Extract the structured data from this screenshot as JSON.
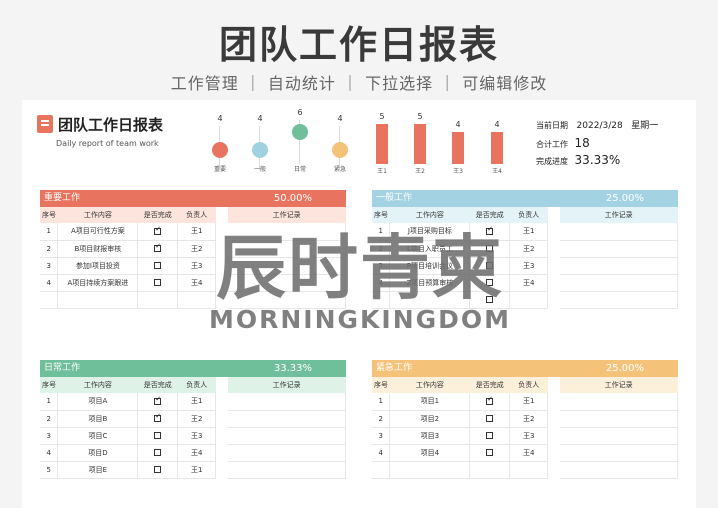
{
  "banner": {
    "title": "团队工作日报表",
    "subtitle": "工作管理 ｜ 自动统计 ｜ 下拉选择 ｜ 可编辑修改"
  },
  "sheet": {
    "title": "团队工作日报表",
    "subtitle": "Daily report of team work"
  },
  "categories": [
    {
      "count": "4",
      "label": "重要",
      "color": "#e8735f"
    },
    {
      "count": "4",
      "label": "一般",
      "color": "#9fd1e0"
    },
    {
      "count": "6",
      "label": "日常",
      "color": "#6fbf9a"
    },
    {
      "count": "4",
      "label": "紧急",
      "color": "#f5c27a"
    }
  ],
  "people": [
    {
      "count": "5",
      "label": "王1",
      "value": 5
    },
    {
      "count": "5",
      "label": "王2",
      "value": 5
    },
    {
      "count": "4",
      "label": "王3",
      "value": 4
    },
    {
      "count": "4",
      "label": "王4",
      "value": 4
    }
  ],
  "stats": {
    "date_label": "当前日期",
    "date_value": "2022/3/28",
    "weekday": "星期一",
    "total_label": "合计工作",
    "total_value": "18",
    "progress_label": "完成进度",
    "progress_value": "33.33%"
  },
  "columns": {
    "no": "序号",
    "content": "工作内容",
    "done": "是否完成",
    "owner": "负责人",
    "record": "工作记录"
  },
  "panels": {
    "important": {
      "title": "重要工作",
      "pct": "50.00%",
      "color": "#e8735f",
      "sub": "#fde4dd",
      "rows": [
        {
          "no": "1",
          "content": "A项目可行性方案",
          "done": true,
          "owner": "王1"
        },
        {
          "no": "2",
          "content": "B项目财报审核",
          "done": true,
          "owner": "王2"
        },
        {
          "no": "3",
          "content": "参加I项目投资",
          "done": false,
          "owner": "王3"
        },
        {
          "no": "4",
          "content": "A项目持续方案跟进",
          "done": false,
          "owner": "王4"
        },
        {
          "no": "",
          "content": "",
          "done": null,
          "owner": ""
        }
      ]
    },
    "normal": {
      "title": "一般工作",
      "pct": "25.00%",
      "color": "#a3d3e2",
      "sub": "#e3f3f8",
      "rows": [
        {
          "no": "1",
          "content": "J项目采购目标",
          "done": true,
          "owner": "王1"
        },
        {
          "no": "2",
          "content": "L项目入职员工",
          "done": false,
          "owner": "王2"
        },
        {
          "no": "3",
          "content": "P项目培训会议",
          "done": false,
          "owner": "王3"
        },
        {
          "no": "4",
          "content": "Z项目预算审核",
          "done": false,
          "owner": "王4"
        },
        {
          "no": "",
          "content": "",
          "done": false,
          "owner": ""
        }
      ]
    },
    "daily": {
      "title": "日常工作",
      "pct": "33.33%",
      "color": "#6fbf9a",
      "sub": "#def2e8",
      "rows": [
        {
          "no": "1",
          "content": "项目A",
          "done": true,
          "owner": "王1"
        },
        {
          "no": "2",
          "content": "项目B",
          "done": true,
          "owner": "王2"
        },
        {
          "no": "3",
          "content": "项目C",
          "done": false,
          "owner": "王3"
        },
        {
          "no": "4",
          "content": "项目D",
          "done": false,
          "owner": "王4"
        },
        {
          "no": "5",
          "content": "项目E",
          "done": false,
          "owner": "王1"
        }
      ]
    },
    "urgent": {
      "title": "紧急工作",
      "pct": "25.00%",
      "color": "#f5c27a",
      "sub": "#fdf0db",
      "rows": [
        {
          "no": "1",
          "content": "项目1",
          "done": true,
          "owner": "王1"
        },
        {
          "no": "2",
          "content": "项目2",
          "done": false,
          "owner": "王2"
        },
        {
          "no": "3",
          "content": "项目3",
          "done": false,
          "owner": "王3"
        },
        {
          "no": "4",
          "content": "项目4",
          "done": false,
          "owner": "王4"
        },
        {
          "no": "",
          "content": "",
          "done": null,
          "owner": ""
        }
      ]
    }
  },
  "watermark": {
    "cn": "辰时青柬",
    "en": "MORNINGKINGDOM"
  }
}
